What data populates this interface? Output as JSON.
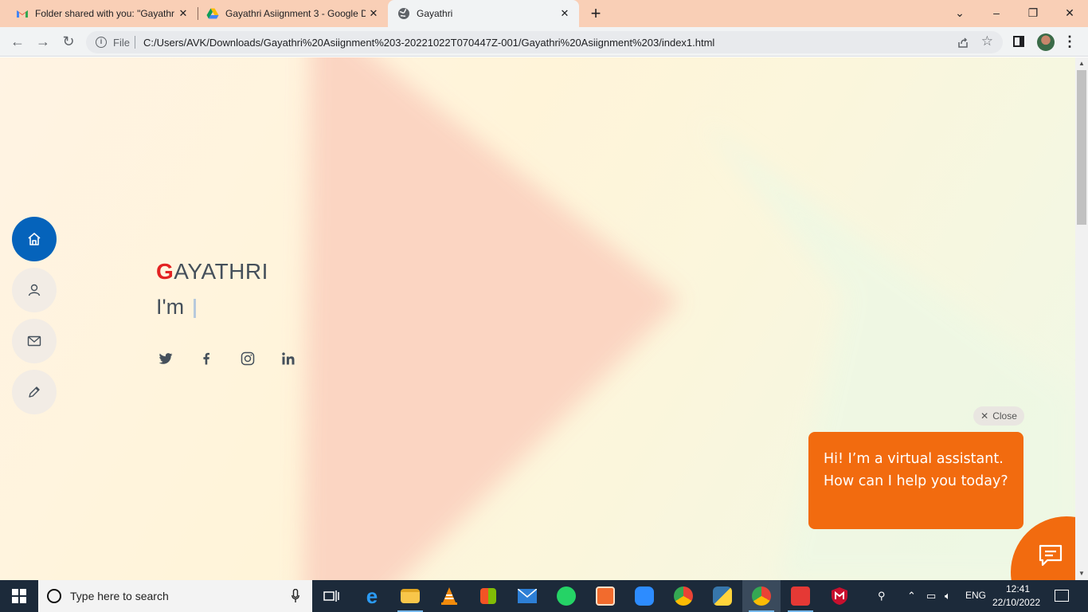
{
  "browser": {
    "tabs": [
      {
        "title": "Folder shared with you: \"Gayathr",
        "icon": "gmail-icon",
        "active": false
      },
      {
        "title": "Gayathri Asiignment 3 - Google D",
        "icon": "google-drive-icon",
        "active": false
      },
      {
        "title": "Gayathri",
        "icon": "globe-icon",
        "active": true
      }
    ],
    "new_tab": "+",
    "omnibox": {
      "scheme_label": "File",
      "url": "C:/Users/AVK/Downloads/Gayathri%20Asiignment%203-20221022T070447Z-001/Gayathri%20Asiignment%203/index1.html"
    }
  },
  "page": {
    "hero": {
      "name_first_letter": "G",
      "name_rest": "AYATHRI",
      "typed_prefix": "I'm"
    },
    "side_nav": [
      "home-icon",
      "person-icon",
      "envelope-icon",
      "pencil-icon"
    ],
    "social": [
      "twitter-icon",
      "facebook-icon",
      "instagram-icon",
      "linkedin-icon"
    ],
    "chat": {
      "close_label": "Close",
      "message": "Hi! I’m a virtual assistant. How can I help you today?"
    },
    "colors": {
      "accent_blue": "#0563bb",
      "name_red": "#e32222",
      "chat_orange": "#f26b0f",
      "text_dark": "#45505b"
    }
  },
  "taskbar": {
    "search_placeholder": "Type here to search",
    "apps": [
      "task-view-icon",
      "edge-icon",
      "file-explorer-icon",
      "vlc-icon",
      "store-icon",
      "mail-icon",
      "whatsapp-icon",
      "app-icon",
      "zoom-icon",
      "chrome-icon",
      "python-icon",
      "chrome-icon",
      "media-app-icon",
      "mcafee-icon"
    ],
    "tray": {
      "language": "ENG",
      "time": "12:41",
      "date": "22/10/2022"
    }
  }
}
